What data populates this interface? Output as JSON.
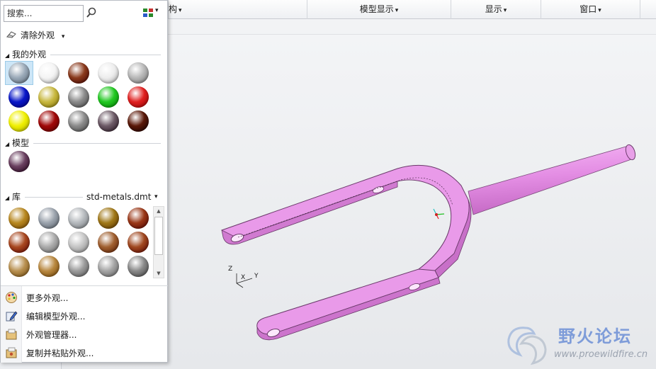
{
  "menubar": {
    "items": [
      {
        "label": "构",
        "caret": "▾"
      },
      {
        "label": "模型显示",
        "caret": "▾"
      },
      {
        "label": "显示",
        "caret": "▾"
      },
      {
        "label": "窗口",
        "caret": "▾"
      }
    ]
  },
  "panel": {
    "search_value": "搜索...",
    "clear_label": "清除外观",
    "clear_caret": "▾",
    "view_caret": "▾",
    "sections": {
      "my": {
        "label": "我的外观",
        "tri": "◢"
      },
      "model": {
        "label": "模型",
        "tri": "◢"
      },
      "library": {
        "label": "库",
        "tri": "◢",
        "file": "std-metals.dmt",
        "caret": "▾"
      }
    },
    "my_swatch_colors": [
      "#9aa9b8",
      "#f4f4f4",
      "#8a3a1c",
      "#ededed",
      "#b8b8b8",
      "#0a18c8",
      "#c8b840",
      "#8a8a8a",
      "#22c822",
      "#e02020",
      "#f0f000",
      "#a00808",
      "#8a8a8a",
      "#6c5a66",
      "#5a1808"
    ],
    "model_swatch_colors": [
      "#6a4060"
    ],
    "library_swatch_colors": [
      "#b88820",
      "#9aa2ac",
      "#b4b8bc",
      "#a07818",
      "#9a3818",
      "#a84820",
      "#aaaaaa",
      "#c4c4c4",
      "#a06030",
      "#a04820",
      "#b89050",
      "#b88840",
      "#9a9a9a",
      "#a4a4a4",
      "#888888"
    ],
    "actions": [
      {
        "label": "更多外观...",
        "icon": "palette-icon"
      },
      {
        "label": "编辑模型外观...",
        "icon": "edit-appearance-icon"
      },
      {
        "label": "外观管理器...",
        "icon": "appearance-manager-icon"
      },
      {
        "label": "复制并粘贴外观...",
        "icon": "copy-paste-appearance-icon"
      }
    ]
  },
  "viewport": {
    "axis_z": "Z",
    "axis_x": "X",
    "axis_y": "Y"
  },
  "watermark": {
    "title": "野火论坛",
    "url": "www.proewildfire.cn"
  },
  "colors": {
    "part_fill": "#e897e8",
    "part_edge": "#6a3a6a"
  }
}
